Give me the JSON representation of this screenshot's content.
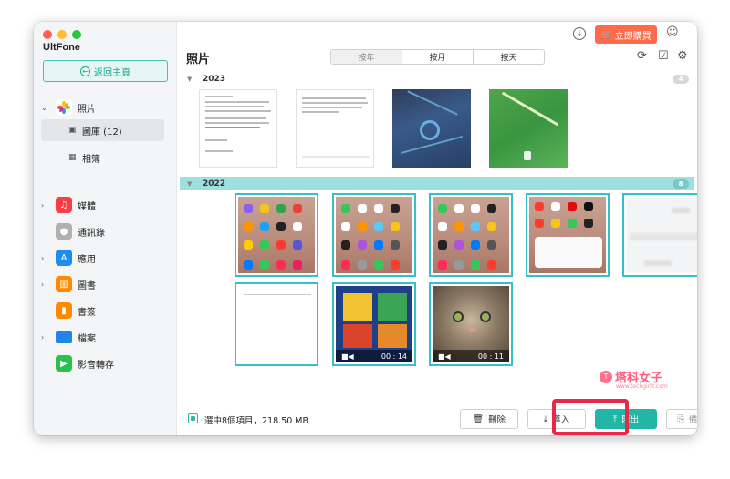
{
  "app": {
    "name": "UltFone"
  },
  "sidebar": {
    "home_label": "返回主頁",
    "items": [
      {
        "label": "照片",
        "icon": "photos-icon",
        "color": "#ffffff",
        "expanded": true
      },
      {
        "label": "圖庫 (12)",
        "icon": "gallery-icon",
        "sub": true,
        "active": true
      },
      {
        "label": "相簿",
        "icon": "album-icon",
        "sub": true
      },
      {
        "label": "媒體",
        "icon": "music-icon",
        "color": "#fc3c44"
      },
      {
        "label": "通訊錄",
        "icon": "contacts-icon",
        "color": "#9e9e9e"
      },
      {
        "label": "應用",
        "icon": "appstore-icon",
        "color": "#1e8cf0"
      },
      {
        "label": "圖書",
        "icon": "books-icon",
        "color": "#ff8a00"
      },
      {
        "label": "書簽",
        "icon": "bookmark-icon",
        "color": "#ff8a00"
      },
      {
        "label": "檔案",
        "icon": "folder-icon",
        "color": "#1f86e6"
      },
      {
        "label": "影音轉存",
        "icon": "video-transfer-icon",
        "color": "#2bc04b"
      }
    ]
  },
  "header": {
    "buy_label": "立即購買",
    "title": "照片",
    "tabs": [
      "按年",
      "按月",
      "按天"
    ],
    "active_tab": "按年"
  },
  "groups": [
    {
      "year": "2023",
      "count": "4",
      "selected": false
    },
    {
      "year": "2022",
      "count": "8",
      "selected": true
    }
  ],
  "videos": [
    {
      "duration": "00 : 14"
    },
    {
      "duration": "00 : 11"
    }
  ],
  "footer": {
    "selection_info": "選中8個項目，218.50 MB",
    "delete_label": "刪除",
    "import_label": "導入",
    "export_label": "匯出",
    "backup_label": "備份"
  },
  "watermark": {
    "name": "塔科女子",
    "url": "www.techgirlz.com"
  },
  "colors": {
    "accent": "#22b6a7",
    "buy": "#ff6b4a",
    "highlight": "#e8284a",
    "selected_header": "#9ee0e0"
  }
}
